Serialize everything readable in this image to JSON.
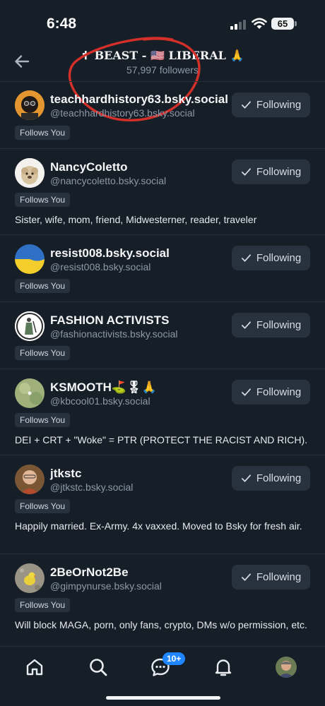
{
  "status": {
    "time": "6:48",
    "battery": "65"
  },
  "header": {
    "title": "✝ BEAST - 🇺🇸 LIBERAL 🙏",
    "subtitle": "57,997 followers"
  },
  "rows": [
    {
      "name": "teachhardhistory63.bsky.social",
      "handle": "@teachhardhistory63.bsky.social",
      "follow_label": "Following",
      "badge": "Follows You",
      "bio": ""
    },
    {
      "name": "NancyColetto",
      "handle": "@nancycoletto.bsky.social",
      "follow_label": "Following",
      "badge": "Follows You",
      "bio": "Sister, wife, mom, friend, Midwesterner, reader, traveler"
    },
    {
      "name": "resist008.bsky.social",
      "handle": "@resist008.bsky.social",
      "follow_label": "Following",
      "badge": "Follows You",
      "bio": ""
    },
    {
      "name": "FASHION ACTIVISTS",
      "handle": "@fashionactivists.bsky.social",
      "follow_label": "Following",
      "badge": "Follows You",
      "bio": ""
    },
    {
      "name": "KSMOOTH⛳🎖🙏",
      "handle": "@kbcool01.bsky.social",
      "follow_label": "Following",
      "badge": "Follows You",
      "bio": "DEI + CRT + \"Woke\" = PTR (PROTECT THE RACIST AND RICH)."
    },
    {
      "name": "jtkstc",
      "handle": "@jtkstc.bsky.social",
      "follow_label": "Following",
      "badge": "Follows You",
      "bio": "Happily married. Ex-Army. 4x vaxxed. Moved to Bsky for fresh air."
    },
    {
      "name": "2BeOrNot2Be",
      "handle": "@gimpynurse.bsky.social",
      "follow_label": "Following",
      "badge": "Follows You",
      "bio": "Will block MAGA, porn, only fans, crypto, DMs w/o permission, etc."
    }
  ],
  "tabbar": {
    "items": [
      "home-icon",
      "search-icon",
      "chat-icon",
      "bell-icon",
      "profile-avatar"
    ],
    "chat_badge": "10+"
  },
  "colors": {
    "background": "#161e27",
    "button": "#28323e",
    "accent": "#1f86ff",
    "annotation": "#d32f2f"
  }
}
